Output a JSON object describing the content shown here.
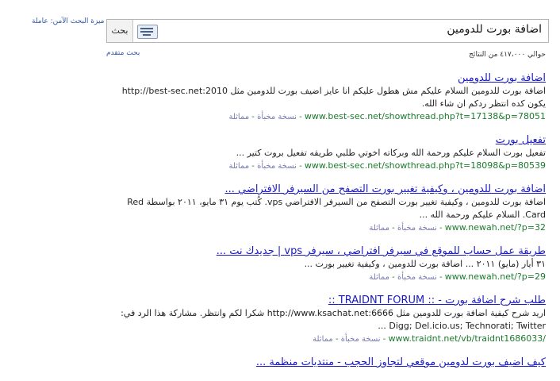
{
  "header": {
    "safe_search": "ميزة البحث الآمن: عاملة",
    "advanced_search": "بحث متقدم",
    "search_button": "بحث",
    "query": "اضافة بورت للدومين",
    "stats": "حوالي ٤١٧،٠٠٠ من النتائج"
  },
  "results": [
    {
      "title": "اضافة بورت للدومين",
      "snippet": "اضافة بورت للدومين السلام عليكم مش هطول عليكم انا عايز اضيف بورت للدومين مثل http://best-sec.net:2010 يكون كده انتظر ردكم ان شاء الله.",
      "url": "www.best-sec.net/showthread.php?t=17138&p=78051",
      "cached": "نسخة مخبأة",
      "similar": "مماثلة"
    },
    {
      "title": "تفعيل بورت",
      "snippet": "تفعيل بورت السلام عليكم ورحمة الله وبركاته اخوتي طلبي طريقه تفعيل بروت كتير ...",
      "url": "www.best-sec.net/showthread.php?t=18098&p=80539",
      "cached": "نسخة مخبأة",
      "similar": "مماثلة"
    },
    {
      "title": "اضافة بورت للدومين ، وكيفية تغيير بورت التصفح من السيرفر الافتراضي ...",
      "snippet": "اضافة بورت للدومين ، وكيفية تغيير بورت التصفح من السيرفر الافتراضي vps. كُتب يوم ٣١ مايو، ٢٠١١ بواسطة Red Card. السلام عليكم ورحمة الله ...",
      "url": "www.newah.net/?p=32",
      "cached": "نسخة مخبأة",
      "similar": "مماثلة"
    },
    {
      "title": "طريقة عمل حساب للموقع في سيرفر افتراضي ، سيرفر vps | جديدك نت ...",
      "snippet": "٣١ أيار (مايو) ٢٠١١ ... اضافة بورت للدومين ، وكيفية تغيير بورت ...",
      "url": "www.newah.net/?p=29",
      "cached": "نسخة مخبأة",
      "similar": "مماثلة"
    },
    {
      "title": "طلب شرح اضافة بورت - :: TRAIDNT FORUM ::",
      "snippet": "اريد شرح كيفية اضافة بورت للدومين مثل http://www.ksachat.net:6666 شكرا لكم وانتظر. مشاركة هذا الرد في: Digg; Del.icio.us; Technorati; Twitter ...",
      "url": "www.traidnt.net/vb/traidnt1686033/",
      "cached": "نسخة مخبأة",
      "similar": "مماثلة"
    },
    {
      "title": "كيف اضيف بورت لدومين موقعي لتجاوز الحجب - منتديات منظمة ...",
      "snippet": "",
      "url": "",
      "cached": "",
      "similar": ""
    }
  ]
}
